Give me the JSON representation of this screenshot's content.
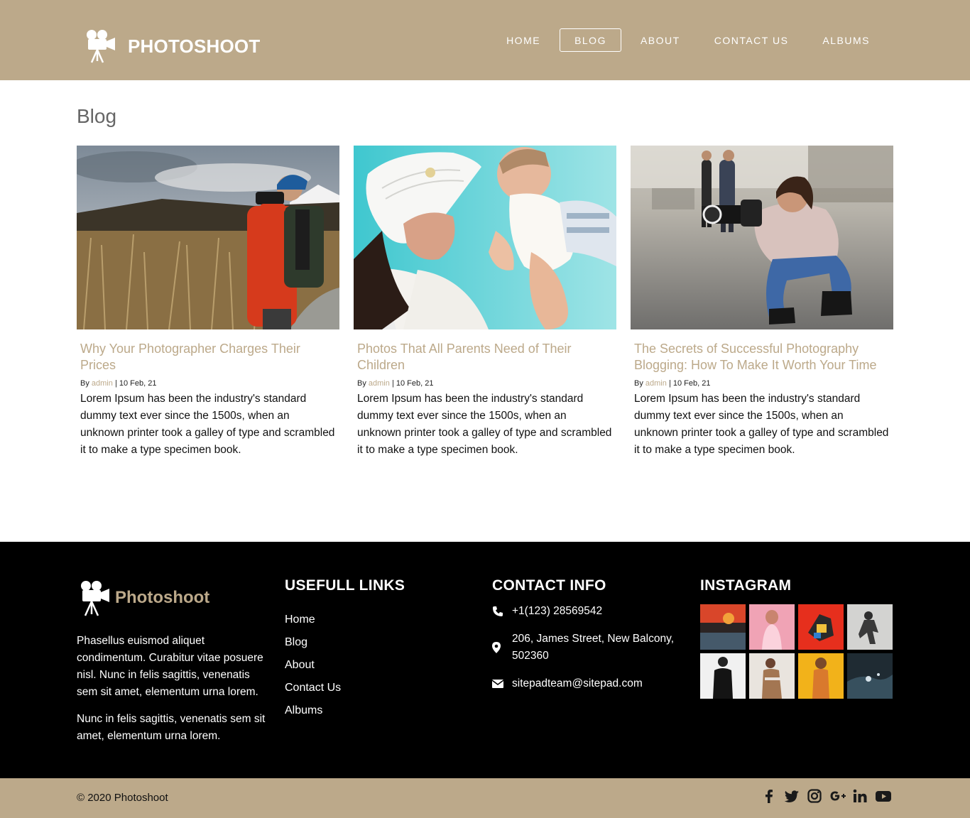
{
  "header": {
    "brand": "PHOTOSHOOT",
    "nav": [
      "HOME",
      "BLOG",
      "ABOUT",
      "CONTACT US",
      "ALBUMS"
    ],
    "active_nav": "BLOG"
  },
  "main": {
    "title": "Blog",
    "posts": [
      {
        "title": "Why Your Photographer Charges Their Prices",
        "by": "By",
        "author": "admin",
        "date": "| 10 Feb, 21",
        "excerpt": "Lorem Ipsum has been the industry's standard dummy text ever since the 1500s, when an unknown printer took a galley of type and scrambled it to make a type specimen book."
      },
      {
        "title": "Photos That All Parents Need of Their Children",
        "by": "By",
        "author": "admin",
        "date": "| 10 Feb, 21",
        "excerpt": "Lorem Ipsum has been the industry's standard dummy text ever since the 1500s, when an unknown printer took a galley of type and scrambled it to make a type specimen book."
      },
      {
        "title": "The Secrets of Successful Photography Blogging: How To Make It Worth Your Time",
        "by": "By",
        "author": "admin",
        "date": "| 10 Feb, 21",
        "excerpt": "Lorem Ipsum has been the industry's standard dummy text ever since the 1500s, when an unknown printer took a galley of type and scrambled it to make a type specimen book."
      }
    ]
  },
  "footer": {
    "brand": "Photoshoot",
    "about": [
      "Phasellus euismod aliquet condimentum. Curabitur vitae posuere nisl. Nunc in felis sagittis, venenatis sem sit amet, elementum urna lorem.",
      "Nunc in felis sagittis, venenatis sem sit amet, elementum urna lorem."
    ],
    "links_heading": "USEFULL LINKS",
    "links": [
      "Home",
      "Blog",
      "About",
      "Contact Us",
      "Albums"
    ],
    "contact_heading": "CONTACT INFO",
    "phone": "+1(123) 28569542",
    "address": "206, James Street, New Balcony, 502360",
    "email": "sitepadteam@sitepad.com",
    "instagram_heading": "INSTAGRAM"
  },
  "bottom": {
    "copyright": "© 2020 Photoshoot",
    "social_icons": [
      "facebook-icon",
      "twitter-icon",
      "instagram-icon",
      "google-plus-icon",
      "linkedin-icon",
      "youtube-icon"
    ]
  },
  "colors": {
    "accent": "#bca98a",
    "footer_bg": "#000000",
    "header_bg": "#bca98a"
  }
}
